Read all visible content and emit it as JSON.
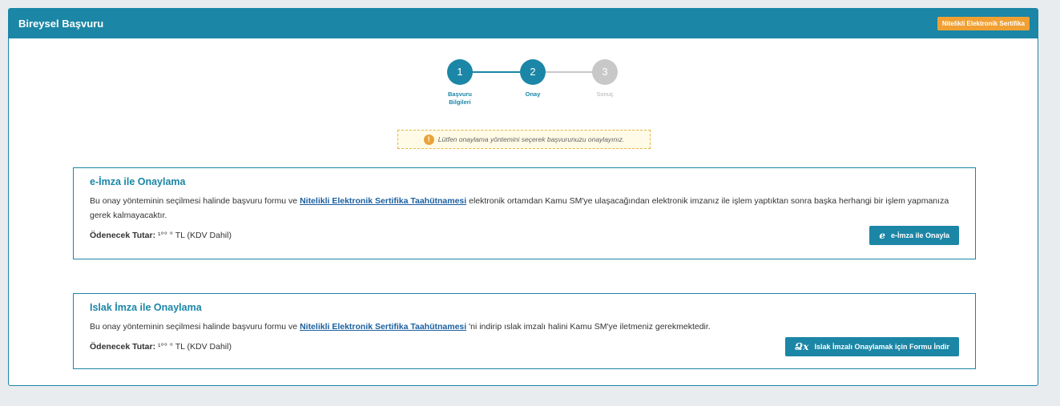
{
  "header": {
    "title": "Bireysel Başvuru",
    "cert_button": "Nitelikli Elektronik Sertifika"
  },
  "stepper": {
    "steps": [
      {
        "number": "1",
        "label_line1": "Başvuru",
        "label_line2": "Bilgileri"
      },
      {
        "number": "2",
        "label_line1": "Onay",
        "label_line2": ""
      },
      {
        "number": "3",
        "label_line1": "Sonuç",
        "label_line2": ""
      }
    ]
  },
  "alert": {
    "icon": "!",
    "text": "Lütfen onaylama yöntemini seçerek başvurunuzu onaylayınız."
  },
  "eimza": {
    "title": "e-İmza ile Onaylama",
    "text_before": "Bu onay yönteminin seçilmesi halinde başvuru formu ve ",
    "link": "Nitelikli Elektronik Sertifika Taahütnamesi",
    "text_after": " elektronik ortamdan Kamu SM'ye ulaşacağından elektronik imzanız ile işlem yaptıktan sonra başka herhangi bir işlem yapmanıza gerek kalmayacaktır.",
    "fee_label": "Ödenecek Tutar:",
    "fee_value": " ¹°° ° TL (KDV Dahil)",
    "button_icon": "e",
    "button_label": "e-İmza ile Onayla"
  },
  "islak": {
    "title": "Islak İmza ile Onaylama",
    "text_before": "Bu onay yönteminin seçilmesi halinde başvuru formu ve ",
    "link": "Nitelikli Elektronik Sertifika Taahütnamesi",
    "text_after": " 'ni indirip ıslak imzalı halini Kamu SM'ye iletmeniz gerekmektedir.",
    "fee_label": "Ödenecek Tutar:",
    "fee_value": " ¹°° ° TL (KDV Dahil)",
    "button_icon": "Ձx",
    "button_label": "Islak İmzalı Onaylamak için Formu İndir"
  }
}
